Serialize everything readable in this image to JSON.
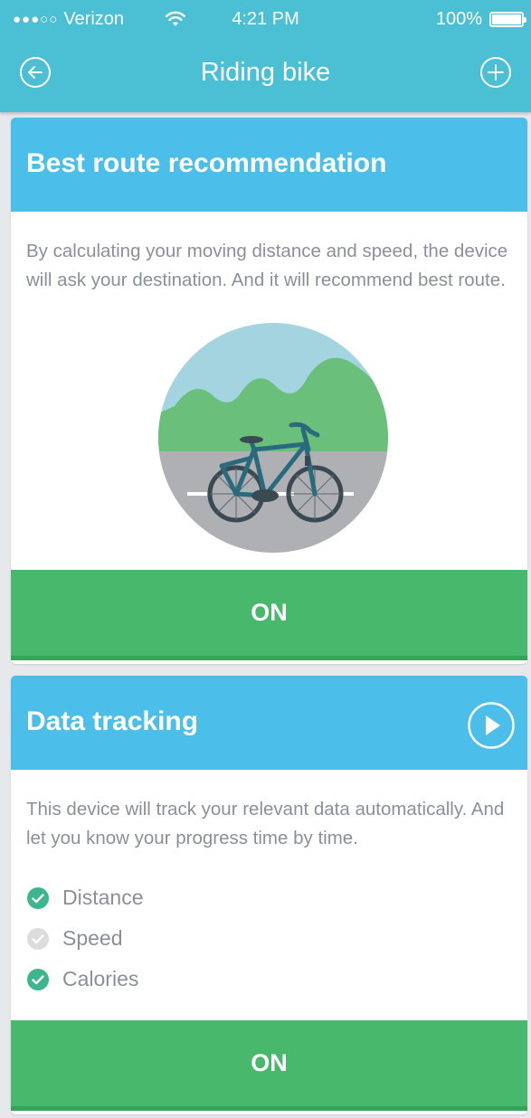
{
  "status_bar": {
    "carrier": "Verizon",
    "time": "4:21 PM",
    "battery": "100%",
    "signal_dots": "●●●○○"
  },
  "nav": {
    "title": "Riding bike",
    "back_icon": "back-arrow-circle-icon",
    "add_icon": "plus-circle-icon"
  },
  "cards": [
    {
      "title": "Best route recommendation",
      "description": "By calculating your moving distance and speed, the device will ask your destination. And it will recommend best route.",
      "illustration": "bicycle-landscape",
      "button_label": "ON"
    },
    {
      "title": "Data tracking",
      "description": "This device will track your relevant data automatically. And let you know your progress time by time.",
      "play_icon": "play-circle-icon",
      "button_label": "ON",
      "items": [
        {
          "label": "Distance",
          "checked": true
        },
        {
          "label": "Speed",
          "checked": false
        },
        {
          "label": "Calories",
          "checked": true
        }
      ]
    }
  ],
  "colors": {
    "header": "#4bbfd3",
    "card_header": "#4bbfe9",
    "on_button": "#48b86c",
    "check_on": "#3db58e",
    "check_off": "#dcdcdc"
  }
}
